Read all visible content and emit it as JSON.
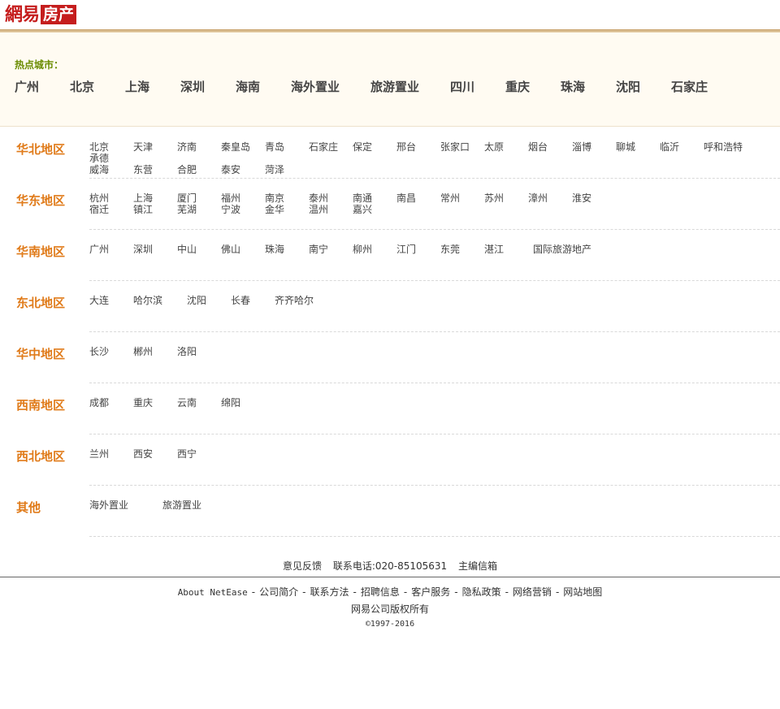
{
  "header": {
    "logo_main": "網易",
    "logo_sub": "房产"
  },
  "hot": {
    "label": "热点城市：",
    "cities": [
      "广州",
      "北京",
      "上海",
      "深圳",
      "海南",
      "海外置业",
      "旅游置业",
      "四川",
      "重庆",
      "珠海",
      "沈阳",
      "石家庄"
    ]
  },
  "regions": [
    {
      "name": "华北地区",
      "rows": [
        [
          "北京",
          "天津",
          "济南",
          "秦皇岛",
          "青岛",
          "石家庄",
          "保定",
          "邢台",
          "张家口",
          "太原",
          "烟台",
          "淄博",
          "聊城",
          "临沂",
          "呼和浩特"
        ],
        [
          "承德"
        ],
        [
          "威海",
          "东营",
          "合肥",
          "泰安",
          "菏泽"
        ]
      ]
    },
    {
      "name": "华东地区",
      "rows": [
        [
          "杭州",
          "上海",
          "厦门",
          "福州",
          "南京",
          "泰州",
          "南通",
          "南昌",
          "常州",
          "苏州",
          "漳州",
          "淮安"
        ],
        [
          "宿迁",
          "镇江",
          "芜湖",
          "宁波",
          "金华",
          "温州",
          "嘉兴"
        ]
      ]
    },
    {
      "name": "华南地区",
      "rows": [
        [
          "广州",
          "深圳",
          "中山",
          "佛山",
          "珠海",
          "南宁",
          "柳州",
          "江门",
          "东莞",
          "湛江",
          "国际旅游地产"
        ]
      ]
    },
    {
      "name": "东北地区",
      "rows": [
        [
          "大连",
          "哈尔滨",
          "沈阳",
          "长春",
          "齐齐哈尔"
        ]
      ]
    },
    {
      "name": "华中地区",
      "rows": [
        [
          "长沙",
          "郴州",
          "洛阳"
        ]
      ]
    },
    {
      "name": "西南地区",
      "rows": [
        [
          "成都",
          "重庆",
          "云南",
          "绵阳"
        ]
      ]
    },
    {
      "name": "西北地区",
      "rows": [
        [
          "兰州",
          "西安",
          "西宁"
        ]
      ]
    },
    {
      "name": "其他",
      "rows": [
        [
          "海外置业",
          "旅游置业"
        ]
      ]
    }
  ],
  "footer": {
    "feedback": "意见反馈",
    "phone": "联系电话:020-85105631",
    "email": "主编信箱",
    "nav": [
      "About NetEase",
      "公司简介",
      "联系方法",
      "招聘信息",
      "客户服务",
      "隐私政策",
      "网络营销",
      "网站地图"
    ],
    "nav_sep": "-",
    "copyright": "网易公司版权所有",
    "years": "©1997-2016"
  },
  "colors": {
    "brand_red": "#c51d1d",
    "region_orange": "#e07b1a",
    "hot_label_green": "#6a8c00"
  }
}
